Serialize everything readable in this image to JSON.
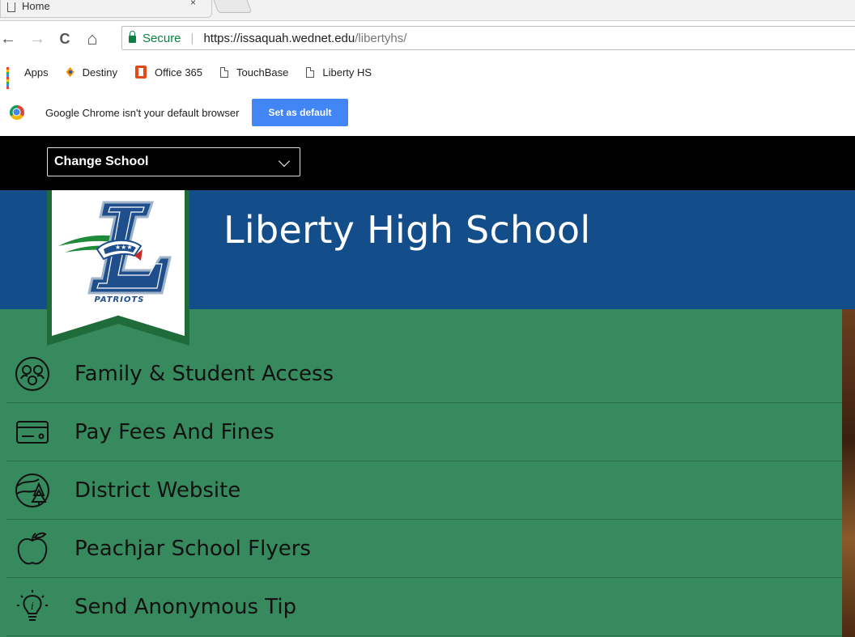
{
  "browser": {
    "tab": {
      "title": "Home",
      "close": "×"
    },
    "nav": {
      "back": "←",
      "forward": "→",
      "reload": "C",
      "home": "⌂"
    },
    "address": {
      "secure_label": "Secure",
      "url_host": "https://issaquah.wednet.edu",
      "url_path": "/libertyhs/"
    },
    "bookmarks": [
      {
        "label": "Apps",
        "icon": "apps-grid-icon"
      },
      {
        "label": "Destiny",
        "icon": "destiny-icon"
      },
      {
        "label": "Office 365",
        "icon": "office365-icon"
      },
      {
        "label": "TouchBase",
        "icon": "page-icon"
      },
      {
        "label": "Liberty HS",
        "icon": "page-icon"
      }
    ],
    "infobar": {
      "message": "Google Chrome isn't your default browser",
      "button": "Set as default"
    },
    "colors": {
      "secure": "#0b8043",
      "button": "#4285f4"
    }
  },
  "site": {
    "change_school": "Change School",
    "school_name": "Liberty High School",
    "logo": {
      "mascot": "PATRIOTS",
      "letter": "L"
    },
    "quick_links": [
      {
        "label": "Family & Student Access",
        "icon": "people-group-icon"
      },
      {
        "label": "Pay Fees And Fines",
        "icon": "credit-card-icon"
      },
      {
        "label": "District Website",
        "icon": "globe-trees-icon"
      },
      {
        "label": "Peachjar School Flyers",
        "icon": "apple-icon"
      },
      {
        "label": "Send Anonymous Tip",
        "icon": "lightbulb-icon"
      }
    ],
    "colors": {
      "header": "#000000",
      "banner": "#134d8a",
      "links_bg": "#378a5e",
      "logo_green": "#1f6b3a"
    }
  }
}
